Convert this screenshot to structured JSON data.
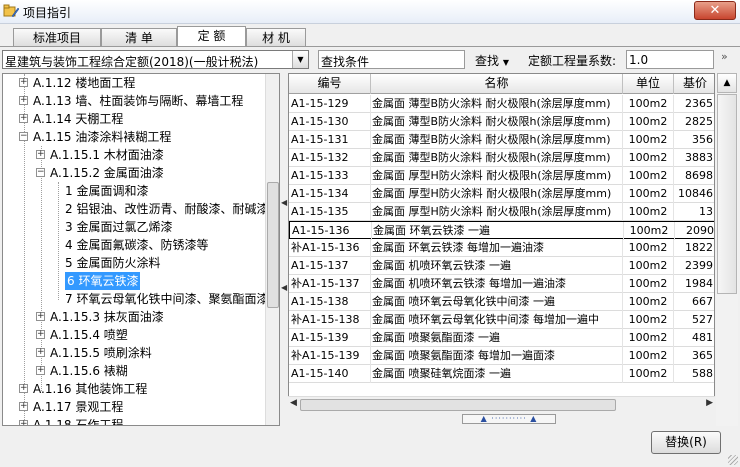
{
  "window": {
    "title": "项目指引",
    "close_icon": "close-icon",
    "app_icon": "folder-pencil-icon"
  },
  "tabs": [
    {
      "label": "标准项目",
      "active": false
    },
    {
      "label": "清 单",
      "active": false
    },
    {
      "label": "定 额",
      "active": true
    },
    {
      "label": "材 机",
      "active": false
    }
  ],
  "toolbar": {
    "quota_library": "星建筑与装饰工程综合定额(2018)(一般计税法)",
    "search_value": "查找条件",
    "find_label": "查找",
    "coef_label": "定额工程量系数:",
    "coef_value": "1.0",
    "more": "»"
  },
  "tree": {
    "rows": [
      {
        "label": "A.1.12 楼地面工程",
        "expander": "+"
      },
      {
        "label": "A.1.13 墙、柱面装饰与隔断、幕墙工程",
        "expander": "+"
      },
      {
        "label": "A.1.14 天棚工程",
        "expander": "+"
      },
      {
        "label": "A.1.15 油漆涂料裱糊工程",
        "expander": "−"
      },
      {
        "label": "A.1.15.1 木材面油漆",
        "expander": "+"
      },
      {
        "label": "A.1.15.2 金属面油漆",
        "expander": "−"
      },
      {
        "label": "1 金属面调和漆",
        "expander": ""
      },
      {
        "label": "2 铝银油、改性沥青、耐酸漆、耐碱漆",
        "expander": ""
      },
      {
        "label": "3 金属面过氯乙烯漆",
        "expander": ""
      },
      {
        "label": "4 金属面氟碳漆、防锈漆等",
        "expander": ""
      },
      {
        "label": "5 金属面防火涂料",
        "expander": ""
      },
      {
        "label": "6 环氧云铁漆",
        "expander": "",
        "selected": true
      },
      {
        "label": "7 环氧云母氧化铁中间漆、聚氨酯面漆",
        "expander": ""
      },
      {
        "label": "A.1.15.3 抹灰面油漆",
        "expander": "+"
      },
      {
        "label": "A.1.15.4 喷塑",
        "expander": "+"
      },
      {
        "label": "A.1.15.5 喷刷涂料",
        "expander": "+"
      },
      {
        "label": "A.1.15.6 裱糊",
        "expander": "+"
      },
      {
        "label": "A.1.16 其他装饰工程",
        "expander": "+"
      },
      {
        "label": "A.1.17 景观工程",
        "expander": "+"
      },
      {
        "label": "A.1.18 石作工程",
        "expander": "+"
      }
    ]
  },
  "grid": {
    "columns": {
      "code": "编号",
      "name": "名称",
      "unit": "单位",
      "price": "基价"
    },
    "rows": [
      {
        "code": "A1-15-129",
        "name": "金属面 薄型B防火涂料 耐火极限h(涂层厚度mm)",
        "unit": "100m2",
        "price": "2365"
      },
      {
        "code": "A1-15-130",
        "name": "金属面 薄型B防火涂料 耐火极限h(涂层厚度mm)",
        "unit": "100m2",
        "price": "2825"
      },
      {
        "code": "A1-15-131",
        "name": "金属面 薄型B防火涂料 耐火极限h(涂层厚度mm)",
        "unit": "100m2",
        "price": "356"
      },
      {
        "code": "A1-15-132",
        "name": "金属面 薄型B防火涂料 耐火极限h(涂层厚度mm)",
        "unit": "100m2",
        "price": "3883"
      },
      {
        "code": "A1-15-133",
        "name": "金属面 厚型H防火涂料 耐火极限h(涂层厚度mm)",
        "unit": "100m2",
        "price": "8698"
      },
      {
        "code": "A1-15-134",
        "name": "金属面 厚型H防火涂料 耐火极限h(涂层厚度mm)",
        "unit": "100m2",
        "price": "10846"
      },
      {
        "code": "A1-15-135",
        "name": "金属面 厚型H防火涂料 耐火极限h(涂层厚度mm)",
        "unit": "100m2",
        "price": "13"
      },
      {
        "code": "A1-15-136",
        "name": "金属面 环氧云铁漆 一遍",
        "unit": "100m2",
        "price": "2090",
        "selected": true
      },
      {
        "code": "补A1-15-136",
        "name": "金属面 环氧云铁漆 每增加一遍油漆",
        "unit": "100m2",
        "price": "1822"
      },
      {
        "code": "A1-15-137",
        "name": "金属面 机喷环氧云铁漆 一遍",
        "unit": "100m2",
        "price": "2399"
      },
      {
        "code": "补A1-15-137",
        "name": "金属面 机喷环氧云铁漆 每增加一遍油漆",
        "unit": "100m2",
        "price": "1984"
      },
      {
        "code": "A1-15-138",
        "name": "金属面 喷环氧云母氧化铁中间漆 一遍",
        "unit": "100m2",
        "price": "667"
      },
      {
        "code": "补A1-15-138",
        "name": "金属面 喷环氧云母氧化铁中间漆 每增加一遍中",
        "unit": "100m2",
        "price": "527"
      },
      {
        "code": "A1-15-139",
        "name": "金属面 喷聚氨酯面漆 一遍",
        "unit": "100m2",
        "price": "481"
      },
      {
        "code": "补A1-15-139",
        "name": "金属面 喷聚氨酯面漆 每增加一遍面漆",
        "unit": "100m2",
        "price": "365"
      },
      {
        "code": "A1-15-140",
        "name": "金属面 喷聚硅氧烷面漆 一遍",
        "unit": "100m2",
        "price": "588"
      }
    ]
  },
  "footer": {
    "replace_label": "替换(R)"
  },
  "colors": {
    "selection": "#3399ff",
    "close_button": "#c8452f"
  }
}
